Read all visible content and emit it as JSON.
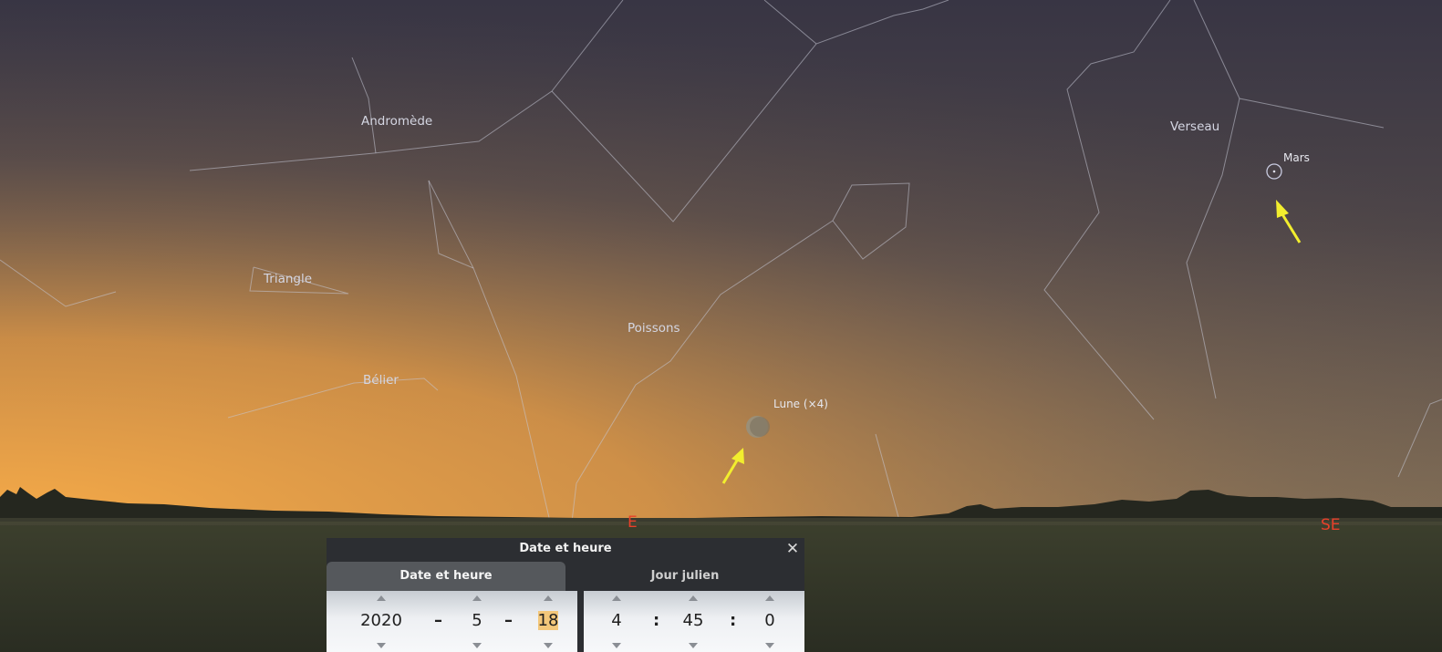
{
  "constellations": {
    "andromeda": "Andromède",
    "triangle": "Triangle",
    "pisces": "Poissons",
    "aries": "Bélier",
    "aquarius": "Verseau"
  },
  "planets": {
    "moon": "Lune (×4)",
    "mars": "Mars"
  },
  "cardinals": {
    "east": "E",
    "southeast": "SE"
  },
  "dialog": {
    "title": "Date et heure",
    "close_icon": "close-icon",
    "tabs": [
      "Date et heure",
      "Jour julien"
    ],
    "active_tab": 0,
    "date": {
      "year": "2020",
      "sep": "–",
      "month": "5",
      "day": "18"
    },
    "time": {
      "hour": "4",
      "sep": ":",
      "minute": "45",
      "second": "0"
    }
  },
  "colors": {
    "cardinal": "#e8402a",
    "arrow": "#f2ee2e",
    "horizon_glow": "#f0a94c"
  }
}
